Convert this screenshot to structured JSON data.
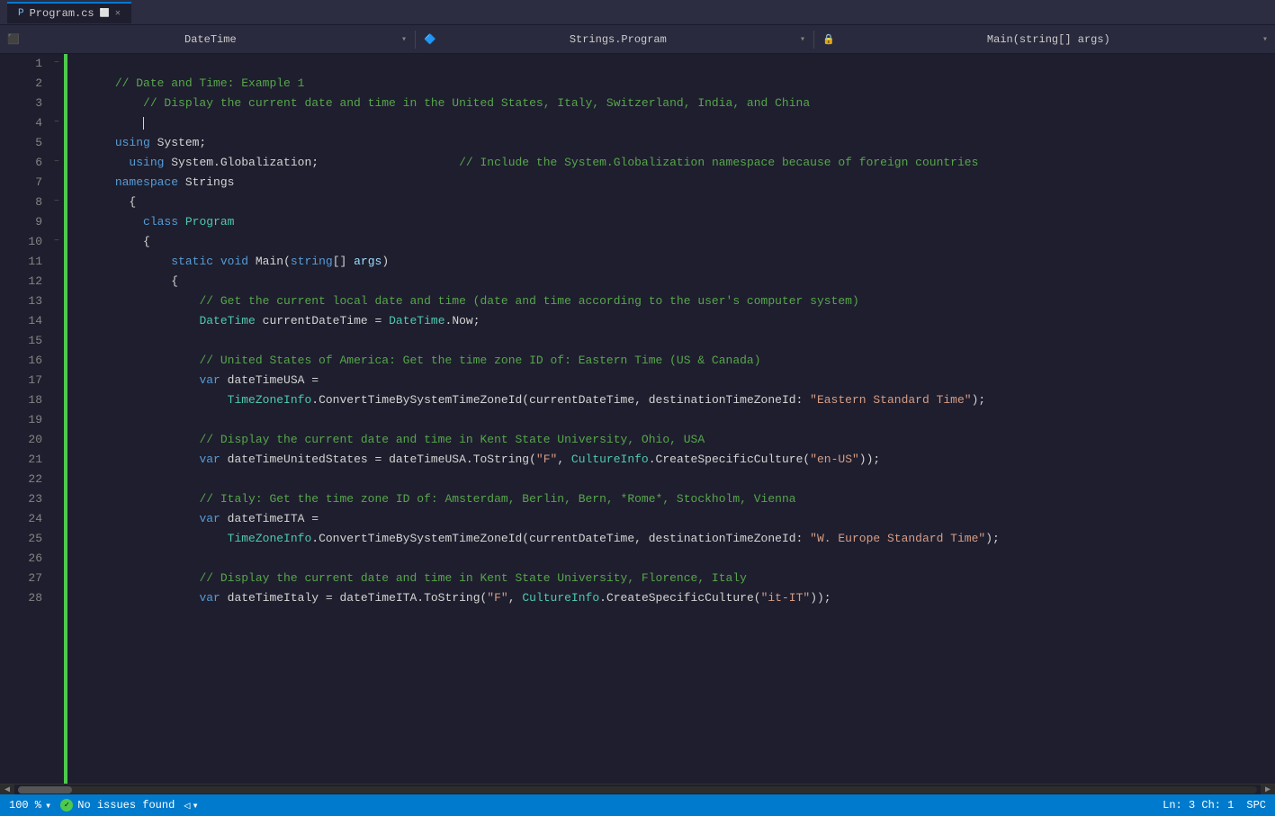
{
  "titleBar": {
    "tab": {
      "filename": "Program.cs",
      "icon": "📄",
      "modified": false
    }
  },
  "navBar": {
    "dropdown1": {
      "icon": "⬛",
      "label": "DateTime",
      "arrow": "▾"
    },
    "dropdown2": {
      "icon": "🔷",
      "label": "Strings.Program",
      "arrow": "▾"
    },
    "dropdown3": {
      "icon": "🔒",
      "label": "Main(string[] args)",
      "arrow": "▾"
    }
  },
  "code": {
    "lines": [
      {
        "num": "1",
        "fold": "−",
        "indent": 0,
        "content": "// Date and Time: Example 1"
      },
      {
        "num": "2",
        "fold": "",
        "indent": 0,
        "content": "    // Display the current date and time in the United States, Italy, Switzerland, India, and China"
      },
      {
        "num": "3",
        "fold": "",
        "indent": 0,
        "content": ""
      },
      {
        "num": "4",
        "fold": "−",
        "indent": 0,
        "content": "using System;"
      },
      {
        "num": "5",
        "fold": "",
        "indent": 0,
        "content": "  using System.Globalization;                    // Include the System.Globalization namespace because of foreign countries"
      },
      {
        "num": "6",
        "fold": "−",
        "indent": 0,
        "content": "namespace Strings"
      },
      {
        "num": "7",
        "fold": "",
        "indent": 0,
        "content": "  {"
      },
      {
        "num": "8",
        "fold": "−",
        "indent": 0,
        "content": "    class Program"
      },
      {
        "num": "9",
        "fold": "",
        "indent": 0,
        "content": "    {"
      },
      {
        "num": "10",
        "fold": "−",
        "indent": 0,
        "content": "        static void Main(string[] args)"
      },
      {
        "num": "11",
        "fold": "",
        "indent": 0,
        "content": "        {"
      },
      {
        "num": "12",
        "fold": "",
        "indent": 0,
        "content": "            // Get the current local date and time (date and time according to the user's computer system)"
      },
      {
        "num": "13",
        "fold": "",
        "indent": 0,
        "content": "            DateTime currentDateTime = DateTime.Now;"
      },
      {
        "num": "14",
        "fold": "",
        "indent": 0,
        "content": ""
      },
      {
        "num": "15",
        "fold": "",
        "indent": 0,
        "content": "            // United States of America: Get the time zone ID of: Eastern Time (US & Canada)"
      },
      {
        "num": "16",
        "fold": "",
        "indent": 0,
        "content": "            var dateTimeUSA ="
      },
      {
        "num": "17",
        "fold": "",
        "indent": 0,
        "content": "                TimeZoneInfo.ConvertTimeBySystemTimeZoneId(currentDateTime, destinationTimeZoneId: \"Eastern Standard Time\");"
      },
      {
        "num": "18",
        "fold": "",
        "indent": 0,
        "content": ""
      },
      {
        "num": "19",
        "fold": "",
        "indent": 0,
        "content": "            // Display the current date and time in Kent State University, Ohio, USA"
      },
      {
        "num": "20",
        "fold": "",
        "indent": 0,
        "content": "            var dateTimeUnitedStates = dateTimeUSA.ToString(\"F\", CultureInfo.CreateSpecificCulture(\"en-US\"));"
      },
      {
        "num": "21",
        "fold": "",
        "indent": 0,
        "content": ""
      },
      {
        "num": "22",
        "fold": "",
        "indent": 0,
        "content": "            // Italy: Get the time zone ID of: Amsterdam, Berlin, Bern, *Rome*, Stockholm, Vienna"
      },
      {
        "num": "23",
        "fold": "",
        "indent": 0,
        "content": "            var dateTimeITA ="
      },
      {
        "num": "24",
        "fold": "",
        "indent": 0,
        "content": "                TimeZoneInfo.ConvertTimeBySystemTimeZoneId(currentDateTime, destinationTimeZoneId: \"W. Europe Standard Time\");"
      },
      {
        "num": "25",
        "fold": "",
        "indent": 0,
        "content": ""
      },
      {
        "num": "26",
        "fold": "",
        "indent": 0,
        "content": "            // Display the current date and time in Kent State University, Florence, Italy"
      },
      {
        "num": "27",
        "fold": "",
        "indent": 0,
        "content": "            var dateTimeItaly = dateTimeITA.ToString(\"F\", CultureInfo.CreateSpecificCulture(\"it-IT\"));"
      },
      {
        "num": "28",
        "fold": "",
        "indent": 0,
        "content": ""
      }
    ]
  },
  "statusBar": {
    "zoom": "100 %",
    "zoomArrow": "▾",
    "issues": "No issues found",
    "navArrows": "◁ ▾",
    "position": "Ln: 3",
    "column": "Ch: 1",
    "encoding": "SPC"
  }
}
